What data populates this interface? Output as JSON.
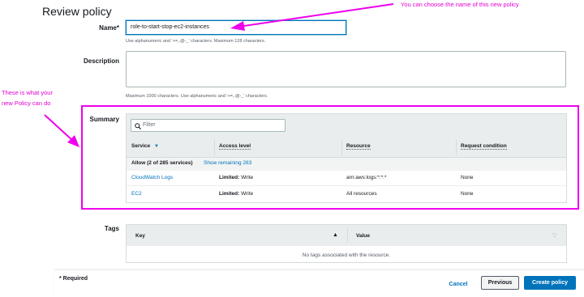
{
  "page": {
    "title": "Review policy"
  },
  "name_field": {
    "label": "Name*",
    "value": "role-to-start-stop-ec2-instances",
    "hint": "Use alphanumeric and '+=,.@-_' characters. Maximum 128 characters."
  },
  "description_field": {
    "label": "Description",
    "value": "",
    "hint": "Maximum 1000 characters. Use alphanumeric and '+=,.@-_' characters."
  },
  "annotations": {
    "name_note": "You can choose the name of this new policy",
    "summary_note_line1": "These is what your",
    "summary_note_line2": "new Policy can do",
    "color": "#ee00ee"
  },
  "summary": {
    "label": "Summary",
    "filter_placeholder": "Filter",
    "columns": [
      "Service",
      "Access level",
      "Resource",
      "Request condition"
    ],
    "allow_text": "Allow (2 of 285 services)",
    "show_remaining": "Show remaining 283",
    "rows": [
      {
        "service": "CloudWatch Logs",
        "access_bold": "Limited:",
        "access_rest": " Write",
        "resource": "arn:aws:logs:*:*:*",
        "condition": "None"
      },
      {
        "service": "EC2",
        "access_bold": "Limited:",
        "access_rest": " Write",
        "resource": "All resources",
        "condition": "None"
      }
    ]
  },
  "tags": {
    "label": "Tags",
    "columns": [
      "Key",
      "Value"
    ],
    "empty_text": "No tags associated with the resource."
  },
  "footer": {
    "required_note": "* Required",
    "cancel": "Cancel",
    "previous": "Previous",
    "create": "Create policy"
  },
  "colors": {
    "primary": "#0073bb",
    "link": "#0073bb",
    "highlight": "#ee00ee"
  }
}
